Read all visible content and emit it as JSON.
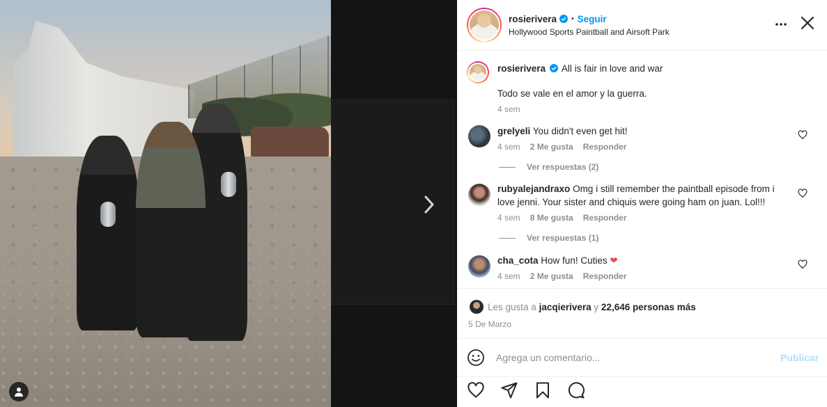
{
  "post": {
    "username": "rosierivera",
    "follow_label": "Seguir",
    "separator": "•",
    "location": "Hollywood Sports Paintball and Airsoft Park"
  },
  "caption": {
    "username": "rosierivera",
    "text": "All is fair in love and war",
    "translation": "Todo se vale en el amor y la guerra.",
    "time": "4 sem"
  },
  "comments": [
    {
      "username": "grelyeli",
      "text": "You didn't even get hit!",
      "time": "4 sem",
      "likes": "2 Me gusta",
      "reply_label": "Responder",
      "view_replies": "Ver respuestas (2)"
    },
    {
      "username": "rubyalejandraxo",
      "text": "Omg i still remember the paintball episode from i love jenni. Your sister and chiquis were going ham on juan. Lol!!!",
      "time": "4 sem",
      "likes": "8 Me gusta",
      "reply_label": "Responder",
      "view_replies": "Ver respuestas (1)"
    },
    {
      "username": "cha_cota",
      "text": "How fun! Cuties",
      "emoji": "❤",
      "time": "4 sem",
      "likes": "2 Me gusta",
      "reply_label": "Responder"
    }
  ],
  "likes": {
    "prefix": "Les gusta a",
    "user": "jacqierivera",
    "connector": "y",
    "others": "22,646 personas más"
  },
  "date": "5 De Marzo",
  "comment_box": {
    "placeholder": "Agrega un comentario...",
    "publish_label": "Publicar"
  },
  "colors": {
    "accent": "#0095f6",
    "publish_disabled": "#b2dffc",
    "heart_red": "#ed4956",
    "muted": "#8e8e8e"
  },
  "icons": [
    "more-options-icon",
    "close-icon",
    "verified-badge-icon",
    "heart-icon",
    "emoji-icon",
    "like-icon",
    "share-icon",
    "save-icon",
    "comment-icon",
    "chevron-right-icon",
    "user-tag-icon"
  ]
}
